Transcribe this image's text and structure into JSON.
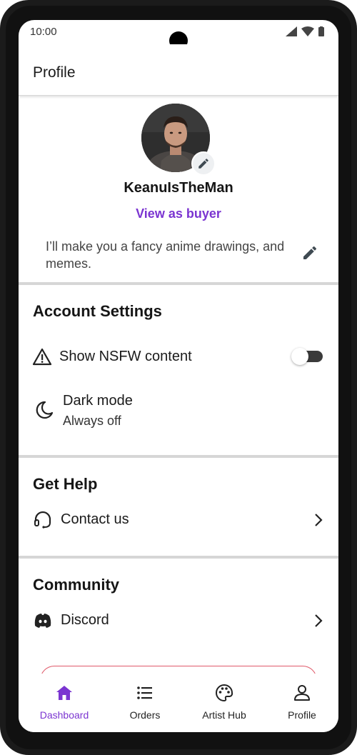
{
  "status_bar": {
    "time": "10:00"
  },
  "header": {
    "title": "Profile"
  },
  "profile": {
    "username": "KeanuIsTheMan",
    "view_as_buyer": "View as buyer",
    "bio": "I’ll make you a fancy anime drawings, and memes."
  },
  "account_settings": {
    "title": "Account Settings",
    "nsfw_label": "Show NSFW content",
    "nsfw_enabled": false,
    "dark_mode_label": "Dark mode",
    "dark_mode_value": "Always off"
  },
  "get_help": {
    "title": "Get Help",
    "contact_label": "Contact us"
  },
  "community": {
    "title": "Community",
    "discord_label": "Discord"
  },
  "bottom_nav": {
    "items": [
      {
        "label": "Dashboard",
        "icon": "home-icon",
        "active": true
      },
      {
        "label": "Orders",
        "icon": "list-icon",
        "active": false
      },
      {
        "label": "Artist Hub",
        "icon": "palette-icon",
        "active": false
      },
      {
        "label": "Profile",
        "icon": "person-icon",
        "active": false
      }
    ]
  },
  "colors": {
    "accent": "#7b35d1",
    "divider": "#d6d6d6",
    "toggle_track": "#3a3a3a"
  }
}
